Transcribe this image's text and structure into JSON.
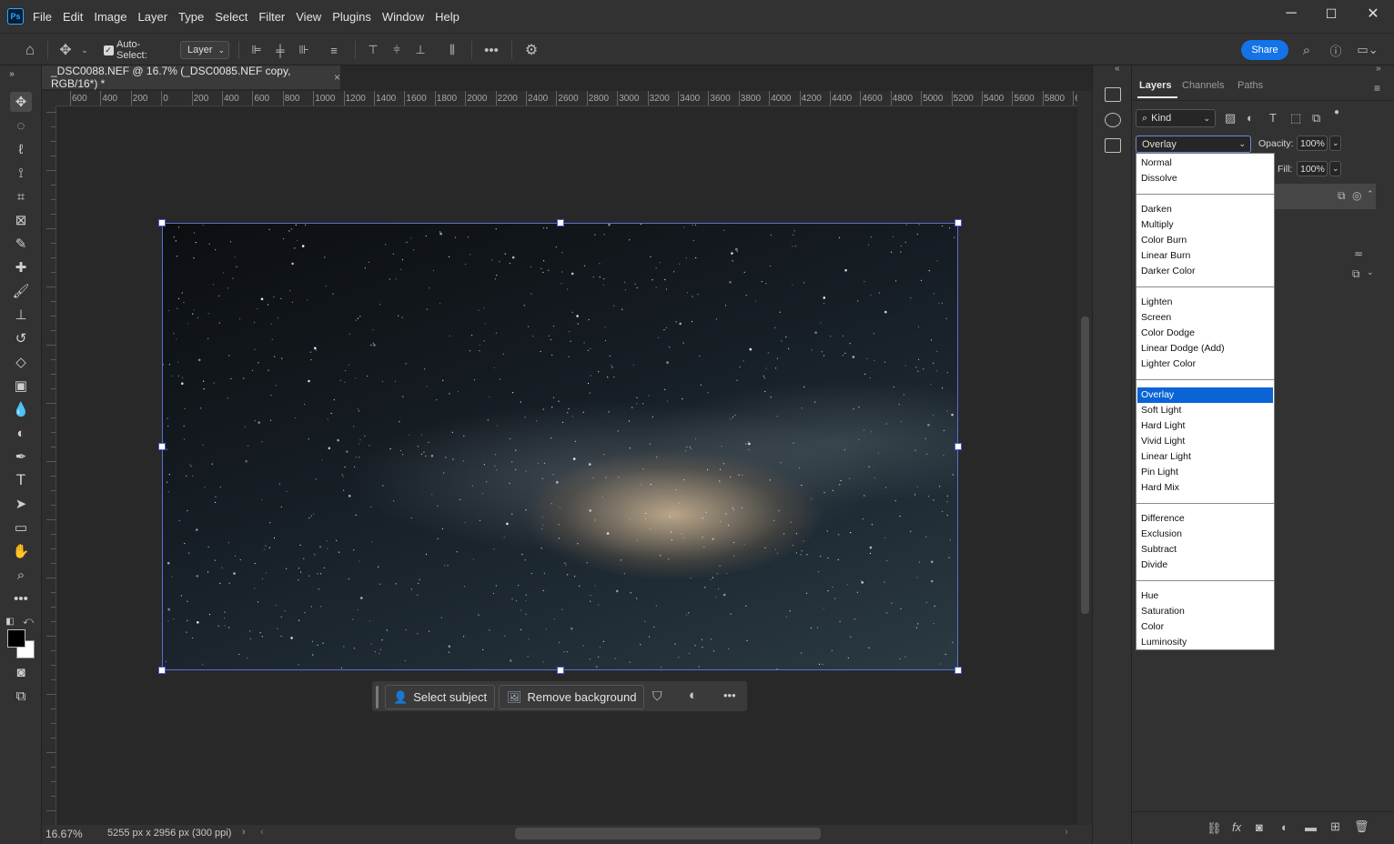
{
  "app": {
    "logo": "Ps"
  },
  "menu": [
    "File",
    "Edit",
    "Image",
    "Layer",
    "Type",
    "Select",
    "Filter",
    "View",
    "Plugins",
    "Window",
    "Help"
  ],
  "window_controls": {
    "minimize": "─",
    "maximize": "☐",
    "close": "✕"
  },
  "options": {
    "auto_select_label": "Auto-Select:",
    "auto_select_checked": true,
    "target_value": "Layer",
    "share_label": "Share"
  },
  "document": {
    "tab_title": "_DSC0088.NEF @ 16.7% (_DSC0085.NEF copy, RGB/16*) *",
    "close": "×"
  },
  "ruler_labels": [
    "600",
    "400",
    "200",
    "0",
    "200",
    "400",
    "600",
    "800",
    "1000",
    "1200",
    "1400",
    "1600",
    "1800",
    "2000",
    "2200",
    "2400",
    "2600",
    "2800",
    "3000",
    "3200",
    "3400",
    "3600",
    "3800",
    "4000",
    "4200",
    "4400",
    "4600",
    "4800",
    "5000",
    "5200",
    "5400",
    "5600",
    "5800",
    "6"
  ],
  "contextual_bar": {
    "select_subject": "Select subject",
    "remove_background": "Remove background"
  },
  "status": {
    "zoom": "16.67%",
    "doc_info": "5255 px x 2956 px (300 ppi)"
  },
  "layers_panel": {
    "tabs": [
      "Layers",
      "Channels",
      "Paths"
    ],
    "filter_kind": "Kind",
    "blend_mode": "Overlay",
    "opacity_label": "Opacity:",
    "opacity_value": "100%",
    "fill_label": "Fill:",
    "fill_value": "100%"
  },
  "blend_modes": {
    "groups": [
      [
        "Normal",
        "Dissolve"
      ],
      [
        "Darken",
        "Multiply",
        "Color Burn",
        "Linear Burn",
        "Darker Color"
      ],
      [
        "Lighten",
        "Screen",
        "Color Dodge",
        "Linear Dodge (Add)",
        "Lighter Color"
      ],
      [
        "Overlay",
        "Soft Light",
        "Hard Light",
        "Vivid Light",
        "Linear Light",
        "Pin Light",
        "Hard Mix"
      ],
      [
        "Difference",
        "Exclusion",
        "Subtract",
        "Divide"
      ],
      [
        "Hue",
        "Saturation",
        "Color",
        "Luminosity"
      ]
    ],
    "selected": "Overlay"
  },
  "colors": {
    "accent": "#0a64d6",
    "share": "#1473e6",
    "selection_box": "#5a6fd6"
  }
}
